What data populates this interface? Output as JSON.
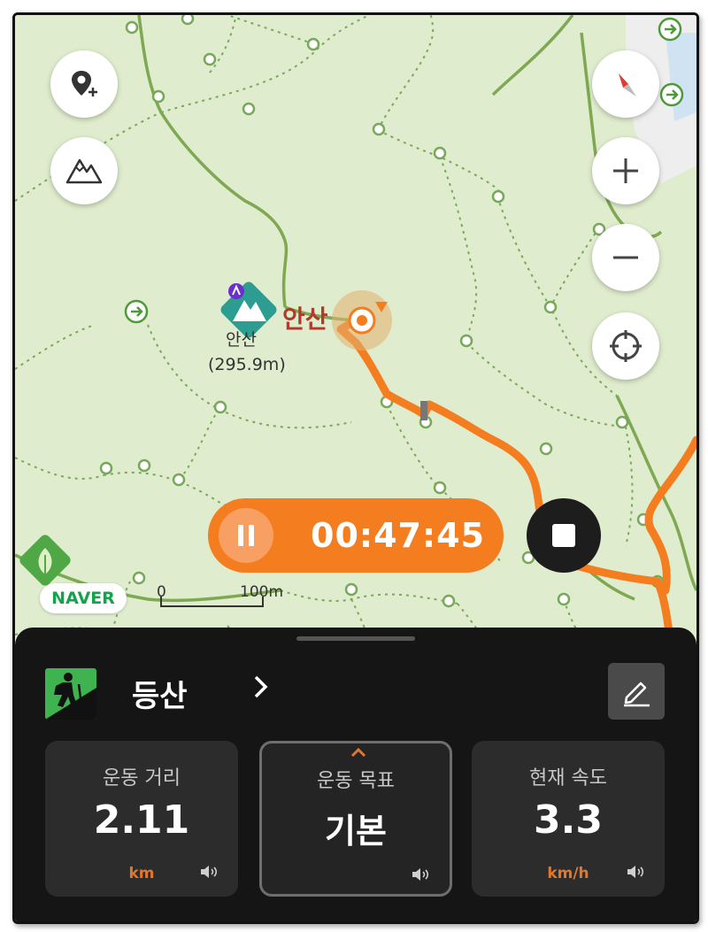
{
  "map": {
    "peak_name": "안산",
    "peak_label": "안산",
    "peak_elevation": "(295.9m)",
    "scale_zero": "0",
    "scale_distance": "100m",
    "brand_badge": "NAVER",
    "colors": {
      "map_bg": "#dfeccd",
      "trail": "#f47d20",
      "road": "#7ea852"
    }
  },
  "controls": {
    "add_location_icon": "location-pin-plus-icon",
    "mountain_icon": "mountain-icon",
    "compass_icon": "compass-icon",
    "zoom_in_icon": "plus-icon",
    "zoom_out_icon": "minus-icon",
    "locate_icon": "crosshair-icon"
  },
  "tracker": {
    "elapsed_time": "00:47:45",
    "pause_icon": "pause-icon",
    "stop_icon": "stop-icon"
  },
  "panel": {
    "activity_name": "등산",
    "activity_icon": "hiker-icon",
    "edit_icon": "pencil-icon",
    "stats": [
      {
        "title": "운동 거리",
        "value": "2.11",
        "unit": "km"
      },
      {
        "title": "운동 목표",
        "value": "기본",
        "unit": ""
      },
      {
        "title": "현재 속도",
        "value": "3.3",
        "unit": "km/h"
      }
    ]
  }
}
